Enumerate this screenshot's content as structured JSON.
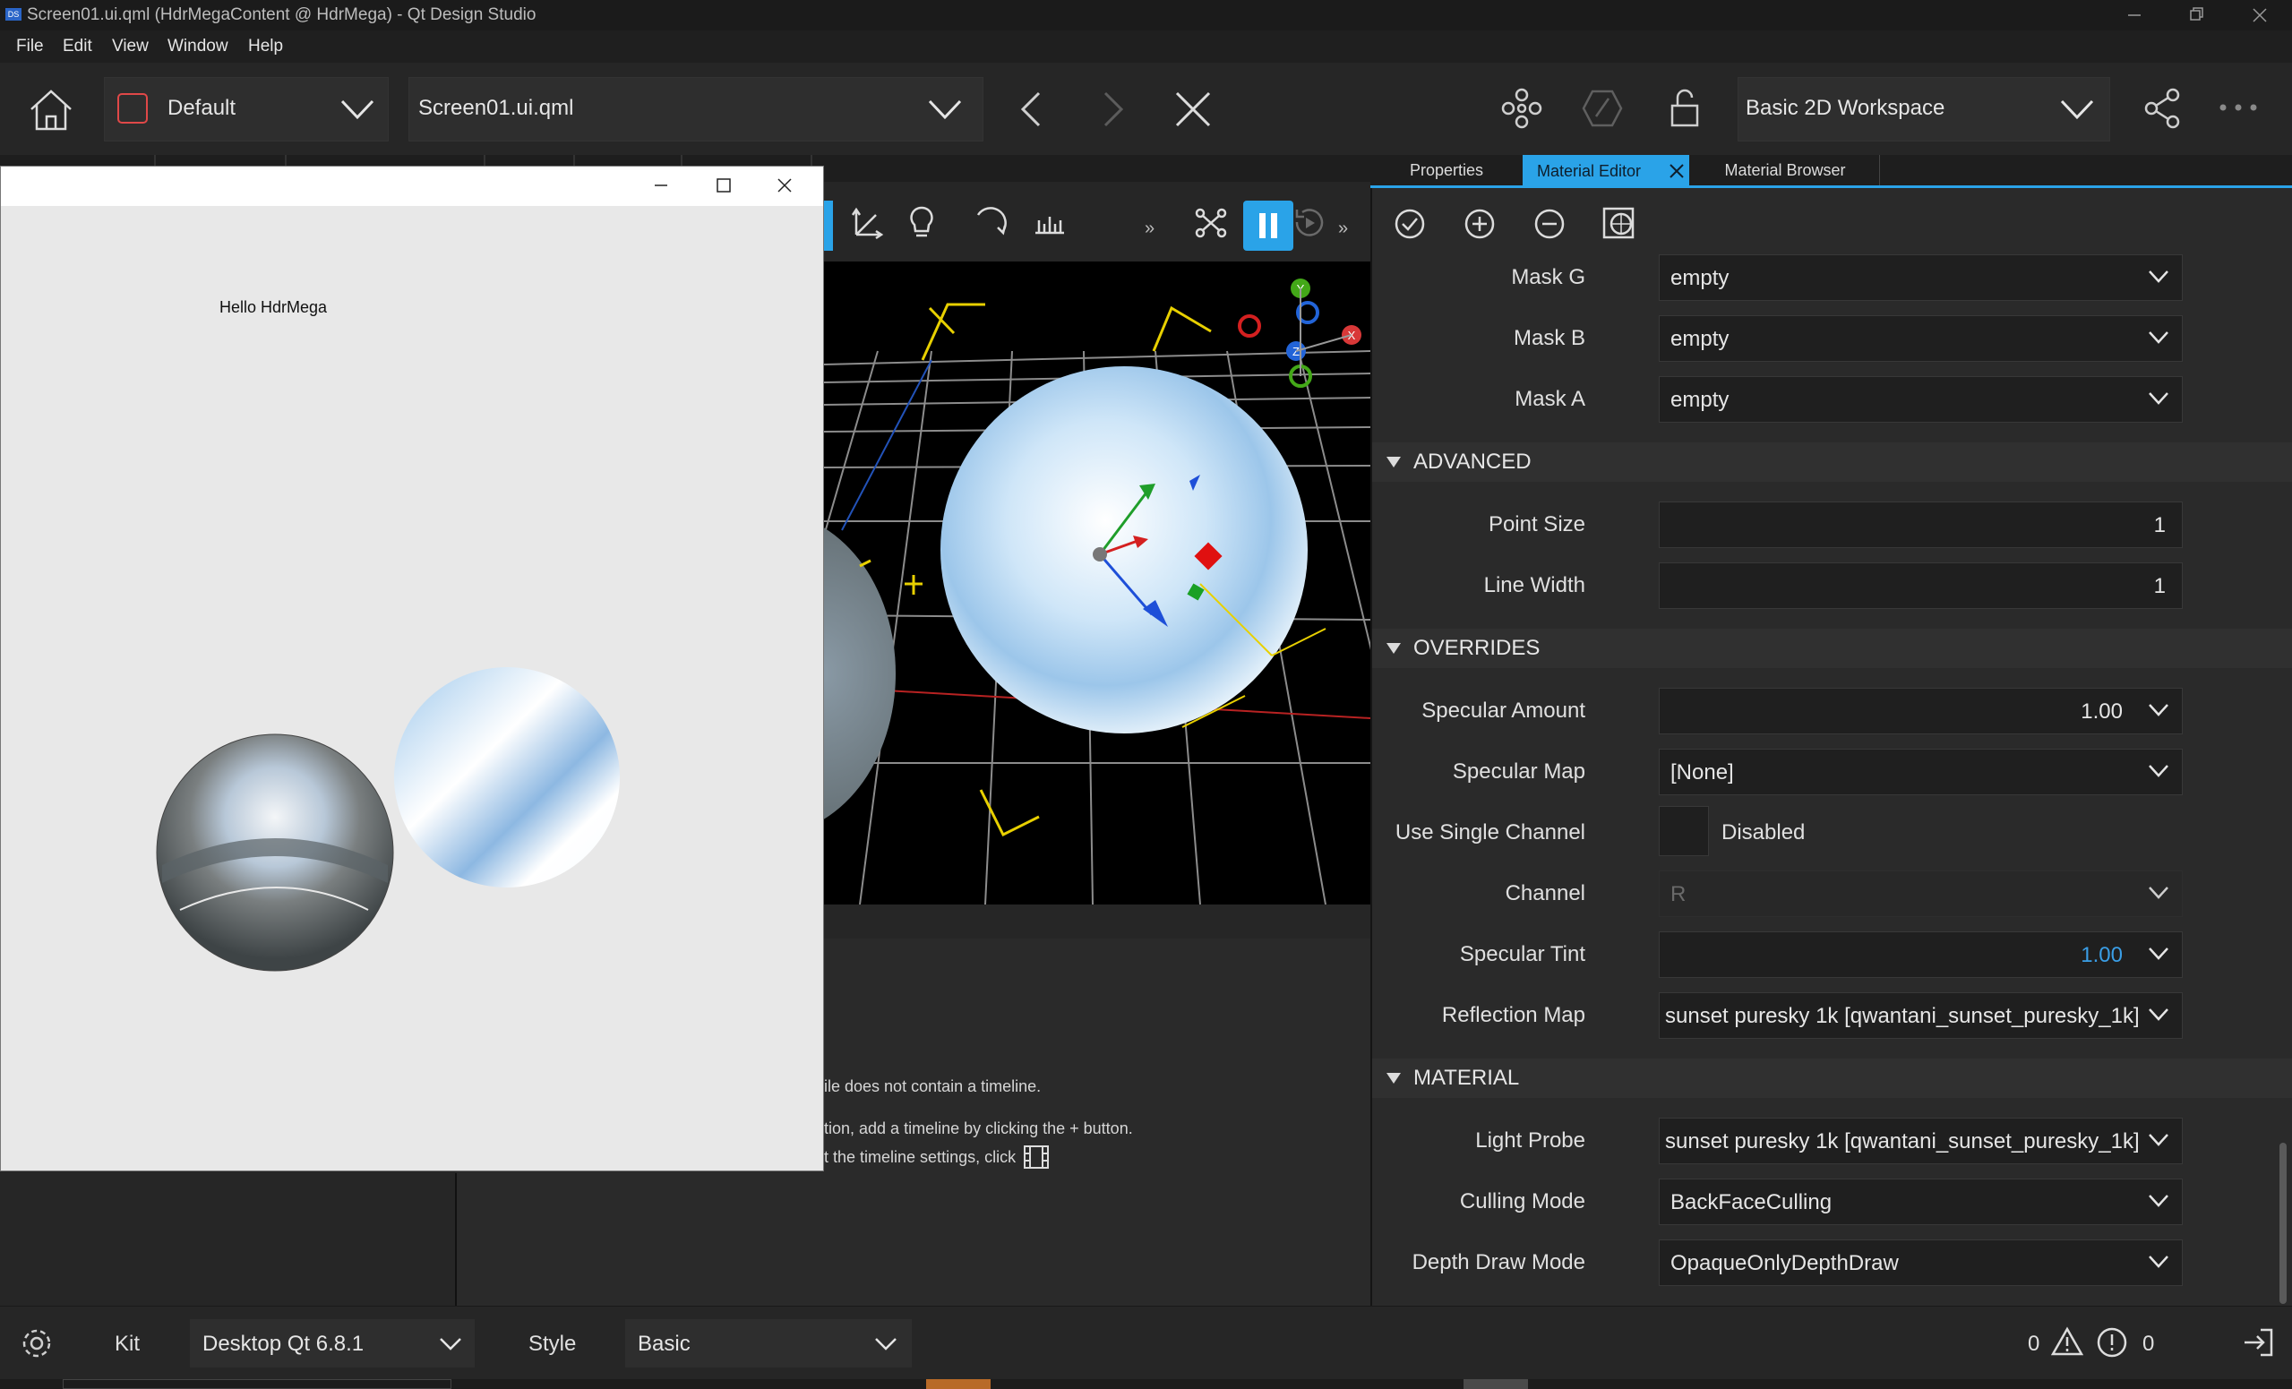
{
  "window": {
    "title": "Screen01.ui.qml (HdrMegaContent @ HdrMega) - Qt Design Studio",
    "app_badge": "DS"
  },
  "menu": [
    "File",
    "Edit",
    "View",
    "Window",
    "Help"
  ],
  "toolbar": {
    "style_combo": "Default",
    "file_combo": "Screen01.ui.qml",
    "workspace_combo": "Basic 2D Workspace"
  },
  "preview": {
    "hello_text": "Hello HdrMega"
  },
  "timeline_messages": [
    "ile does not contain a timeline.",
    "tion, add a timeline by clicking the + button.",
    "t the timeline settings, click"
  ],
  "right_tabs": [
    "Properties",
    "Material Editor",
    "Material Browser"
  ],
  "properties": {
    "mask_g": {
      "label": "Mask G",
      "value": "empty"
    },
    "mask_b": {
      "label": "Mask B",
      "value": "empty"
    },
    "mask_a": {
      "label": "Mask A",
      "value": "empty"
    },
    "advanced_header": "ADVANCED",
    "point_size": {
      "label": "Point Size",
      "value": "1"
    },
    "line_width": {
      "label": "Line Width",
      "value": "1"
    },
    "overrides_header": "OVERRIDES",
    "specular_amount": {
      "label": "Specular Amount",
      "value": "1.00"
    },
    "specular_map": {
      "label": "Specular Map",
      "value": "[None]"
    },
    "use_single_channel": {
      "label": "Use Single Channel",
      "value": "Disabled"
    },
    "channel": {
      "label": "Channel",
      "value": "R"
    },
    "specular_tint": {
      "label": "Specular Tint",
      "value": "1.00"
    },
    "reflection_map": {
      "label": "Reflection Map",
      "value": "sunset puresky 1k [qwantani_sunset_puresky_1k]"
    },
    "material_header": "MATERIAL",
    "light_probe": {
      "label": "Light Probe",
      "value": "sunset puresky 1k [qwantani_sunset_puresky_1k]"
    },
    "culling_mode": {
      "label": "Culling Mode",
      "value": "BackFaceCulling"
    },
    "depth_draw_mode": {
      "label": "Depth Draw Mode",
      "value": "OpaqueOnlyDepthDraw"
    }
  },
  "statusbar": {
    "kit_label": "Kit",
    "kit_value": "Desktop Qt 6.8.1",
    "style_label": "Style",
    "style_value": "Basic",
    "warnings": "0",
    "errors": "0"
  },
  "colors": {
    "accent": "#2aa3e8",
    "spec_tint_value": "#3a9ee6"
  }
}
